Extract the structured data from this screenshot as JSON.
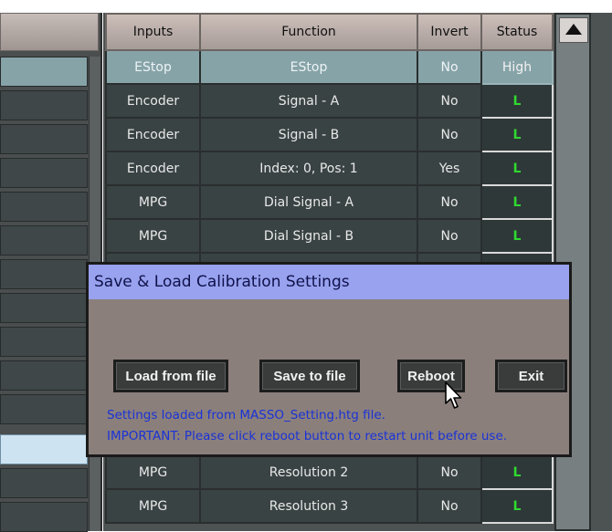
{
  "table": {
    "headers": [
      "Inputs",
      "Function",
      "Invert",
      "Status"
    ],
    "rows": [
      {
        "input": "EStop",
        "function": "EStop",
        "invert": "No",
        "status": "High",
        "selected": true
      },
      {
        "input": "Encoder",
        "function": "Signal - A",
        "invert": "No",
        "status": "L"
      },
      {
        "input": "Encoder",
        "function": "Signal - B",
        "invert": "No",
        "status": "L"
      },
      {
        "input": "Encoder",
        "function": "Index: 0, Pos: 1",
        "invert": "Yes",
        "status": "L"
      },
      {
        "input": "MPG",
        "function": "Dial Signal - A",
        "invert": "No",
        "status": "L"
      },
      {
        "input": "MPG",
        "function": "Dial Signal - B",
        "invert": "No",
        "status": "L"
      },
      {
        "input": "MPG",
        "function": "Resolution 2",
        "invert": "No",
        "status": "L"
      },
      {
        "input": "MPG",
        "function": "Resolution 3",
        "invert": "No",
        "status": "L"
      }
    ]
  },
  "dialog": {
    "title": "Save & Load Calibration Settings",
    "buttons": {
      "load": "Load from file",
      "save": "Save to file",
      "reboot": "Reboot",
      "exit": "Exit"
    },
    "message_line1": "Settings loaded from MASSO_Setting.htg file.",
    "message_line2": "IMPORTANT: Please click reboot button to restart unit before use."
  },
  "colors": {
    "status_low": "#2fd82f",
    "dialog_title_bg": "#98a2ef",
    "message_text": "#1a33d6"
  },
  "icons": {
    "scroll_up": "triangle-up-icon",
    "cursor": "mouse-pointer-icon"
  }
}
